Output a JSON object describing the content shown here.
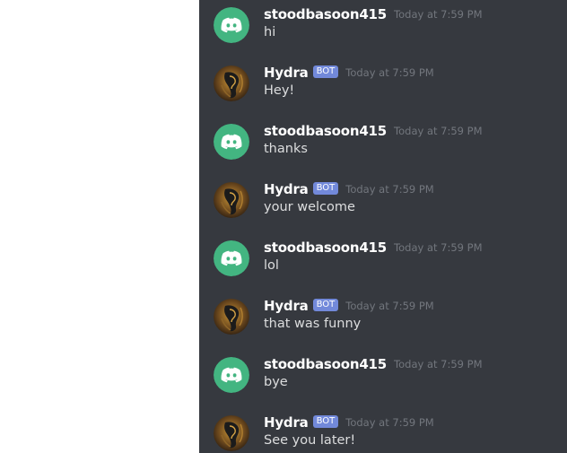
{
  "colors": {
    "background": "#ffffff",
    "chat_background": "#36393f",
    "discord_green": "#43b581",
    "bot_tag": "#7289da",
    "timestamp": "#72767d",
    "message_text": "#dcddde",
    "username": "#ffffff"
  },
  "messages": [
    {
      "author": "stoodbasoon415",
      "bot": false,
      "bot_label": "",
      "time": "Today at 7:59 PM",
      "text": "hi",
      "avatar_icon": "discord-logo-icon"
    },
    {
      "author": "Hydra",
      "bot": true,
      "bot_label": "BOT",
      "time": "Today at 7:59 PM",
      "text": "Hey!",
      "avatar_icon": "hydra-dragon-avatar"
    },
    {
      "author": "stoodbasoon415",
      "bot": false,
      "bot_label": "",
      "time": "Today at 7:59 PM",
      "text": "thanks",
      "avatar_icon": "discord-logo-icon"
    },
    {
      "author": "Hydra",
      "bot": true,
      "bot_label": "BOT",
      "time": "Today at 7:59 PM",
      "text": "your welcome",
      "avatar_icon": "hydra-dragon-avatar"
    },
    {
      "author": "stoodbasoon415",
      "bot": false,
      "bot_label": "",
      "time": "Today at 7:59 PM",
      "text": "lol",
      "avatar_icon": "discord-logo-icon"
    },
    {
      "author": "Hydra",
      "bot": true,
      "bot_label": "BOT",
      "time": "Today at 7:59 PM",
      "text": "that was funny",
      "avatar_icon": "hydra-dragon-avatar"
    },
    {
      "author": "stoodbasoon415",
      "bot": false,
      "bot_label": "",
      "time": "Today at 7:59 PM",
      "text": "bye",
      "avatar_icon": "discord-logo-icon"
    },
    {
      "author": "Hydra",
      "bot": true,
      "bot_label": "BOT",
      "time": "Today at 7:59 PM",
      "text": "See you later!",
      "avatar_icon": "hydra-dragon-avatar"
    }
  ]
}
